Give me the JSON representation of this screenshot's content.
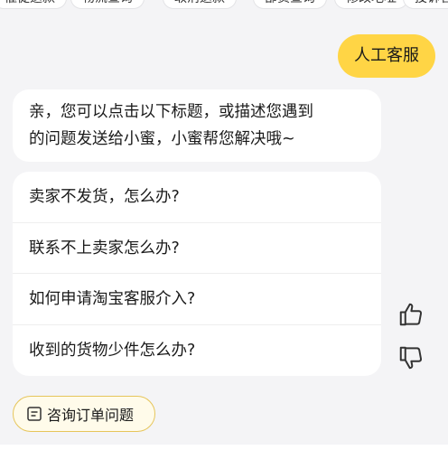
{
  "quick_chips": [
    "催促退款",
    "物流查询",
    "取消退款",
    "部货查询",
    "修改地址",
    "投诉客"
  ],
  "user_message": "人工客服",
  "bot_message": {
    "line1": "亲，您可以点击以下标题，或描述您遇到",
    "line2": "的问题发送给小蜜，小蜜帮您解决哦~"
  },
  "questions": [
    "卖家不发货，怎么办?",
    "联系不上卖家怎么办?",
    "如何申请淘宝客服介入?",
    "收到的货物少件怎么办?"
  ],
  "feedback": {
    "like_icon": "thumbs-up-icon",
    "dislike_icon": "thumbs-down-icon"
  },
  "order_button": {
    "icon": "order-form-icon",
    "label": "咨询订单问题"
  },
  "colors": {
    "accent": "#ffd545",
    "background": "#f4f4f6",
    "button_border": "#e6c55a"
  }
}
